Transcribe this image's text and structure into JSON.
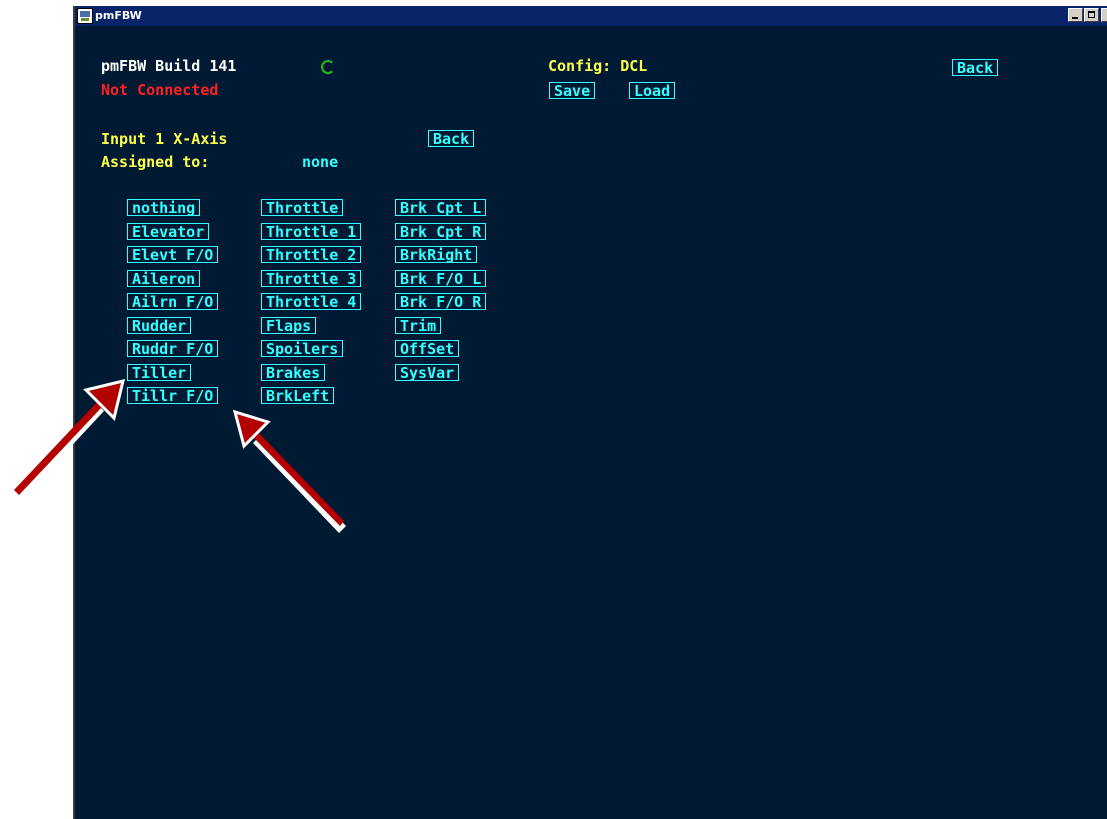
{
  "window": {
    "title": "pmFBW"
  },
  "header": {
    "build": "pmFBW Build 141",
    "status": "Not Connected",
    "config": "Config: DCL",
    "back_label": "Back",
    "save_label": "Save",
    "load_label": "Load"
  },
  "input": {
    "title": "Input 1 X-Axis",
    "back_label": "Back",
    "assigned_label": "Assigned to:",
    "assigned_value": "none"
  },
  "assignments": {
    "col1": [
      "nothing",
      "Elevator",
      "Elevt F/O",
      "Aileron",
      "Ailrn F/O",
      "Rudder",
      "Ruddr F/O",
      "Tiller",
      "Tillr F/O"
    ],
    "col2": [
      "Throttle",
      "Throttle 1",
      "Throttle 2",
      "Throttle 3",
      "Throttle 4",
      "Flaps",
      "Spoilers",
      "Brakes",
      "BrkLeft"
    ],
    "col3": [
      "Brk Cpt L",
      "Brk Cpt R",
      "BrkRight",
      "Brk F/O L",
      "Brk F/O R",
      "Trim",
      "OffSet",
      "SysVar"
    ]
  },
  "colors": {
    "background": "#001a33",
    "accent_cyan": "#33ffff",
    "label_yellow": "#ffff4a",
    "status_red": "#ff2020",
    "annotation_arrow": "#b30000"
  },
  "icons": {
    "app": "pmfbw-app-icon",
    "activity": "spinner-icon"
  }
}
